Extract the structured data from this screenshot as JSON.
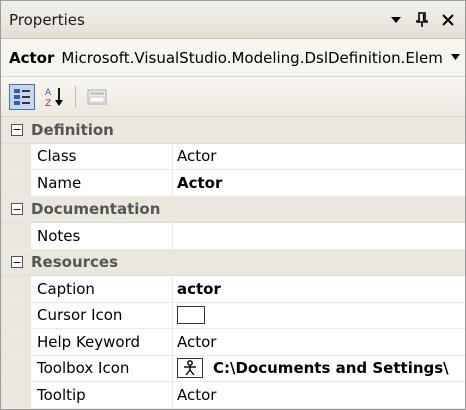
{
  "window": {
    "title": "Properties",
    "buttons": {
      "dropdown": "▾",
      "pin": "ᵾ",
      "close": "✕"
    }
  },
  "selector": {
    "name": "Actor",
    "type": "Microsoft.VisualStudio.Modeling.DslDefinition.Elem"
  },
  "toolbar": {
    "categorized_icon": "categorized-icon",
    "alphabetical_icon": "alphabetical-icon",
    "property_pages_icon": "property-pages-icon"
  },
  "categories": [
    {
      "label": "Definition",
      "properties": [
        {
          "name": "Class",
          "value": "Actor",
          "bold": false
        },
        {
          "name": "Name",
          "value": "Actor",
          "bold": true
        }
      ]
    },
    {
      "label": "Documentation",
      "properties": [
        {
          "name": "Notes",
          "value": "",
          "bold": false
        }
      ]
    },
    {
      "label": "Resources",
      "properties": [
        {
          "name": "Caption",
          "value": "actor",
          "bold": true
        },
        {
          "name": "Cursor Icon",
          "value": "",
          "bold": false
        },
        {
          "name": "Help Keyword",
          "value": "Actor",
          "bold": false
        },
        {
          "name": "Toolbox Icon",
          "value": "C:\\Documents and Settings\\",
          "bold": true
        },
        {
          "name": "Tooltip",
          "value": "Actor",
          "bold": false
        }
      ]
    }
  ],
  "colors": {
    "category_bg": "#e9e7de",
    "active_tool_bg": "#c6d6ef",
    "active_tool_border": "#4a6ea9"
  }
}
